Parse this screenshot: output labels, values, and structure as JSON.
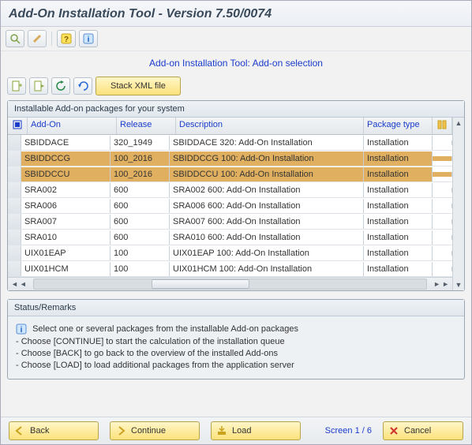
{
  "title": "Add-On Installation Tool - Version 7.50/0074",
  "subtitle": "Add-on Installation Tool: Add-on selection",
  "stack_button": "Stack XML file",
  "panel_title": "Installable Add-on packages for your system",
  "columns": {
    "addon": "Add-On",
    "release": "Release",
    "description": "Description",
    "package_type": "Package type"
  },
  "rows": [
    {
      "addon": "SBIDDACE",
      "release": "320_1949",
      "description": "SBIDDACE 320: Add-On Installation",
      "package_type": "Installation",
      "highlight": false
    },
    {
      "addon": "SBIDDCCG",
      "release": "100_2016",
      "description": "SBIDDCCG 100: Add-On Installation",
      "package_type": "Installation",
      "highlight": true
    },
    {
      "addon": "SBIDDCCU",
      "release": "100_2016",
      "description": "SBIDDCCU 100: Add-On Installation",
      "package_type": "Installation",
      "highlight": true,
      "red_marks": true
    },
    {
      "addon": "SRA002",
      "release": "600",
      "description": "SRA002 600: Add-On Installation",
      "package_type": "Installation",
      "highlight": false
    },
    {
      "addon": "SRA006",
      "release": "600",
      "description": "SRA006 600: Add-On Installation",
      "package_type": "Installation",
      "highlight": false
    },
    {
      "addon": "SRA007",
      "release": "600",
      "description": "SRA007 600: Add-On Installation",
      "package_type": "Installation",
      "highlight": false
    },
    {
      "addon": "SRA010",
      "release": "600",
      "description": "SRA010 600: Add-On Installation",
      "package_type": "Installation",
      "highlight": false
    },
    {
      "addon": "UIX01EAP",
      "release": "100",
      "description": "UIX01EAP 100: Add-On Installation",
      "package_type": "Installation",
      "highlight": false
    },
    {
      "addon": "UIX01HCM",
      "release": "100",
      "description": "UIX01HCM 100: Add-On Installation",
      "package_type": "Installation",
      "highlight": false
    }
  ],
  "status": {
    "title": "Status/Remarks",
    "lines": [
      "Select one or several packages from the installable Add-on packages",
      "- Choose [CONTINUE] to start the calculation of the installation queue",
      "- Choose [BACK] to go back to the overview of the installed Add-ons",
      "- Choose [LOAD] to load additional packages from the application server"
    ]
  },
  "footer": {
    "back": "Back",
    "continue": "Continue",
    "load": "Load",
    "screen": "Screen 1 / 6",
    "cancel": "Cancel"
  },
  "icons": {
    "select_all": "select-all-icon",
    "help": "help-icon",
    "info": "info-icon"
  }
}
